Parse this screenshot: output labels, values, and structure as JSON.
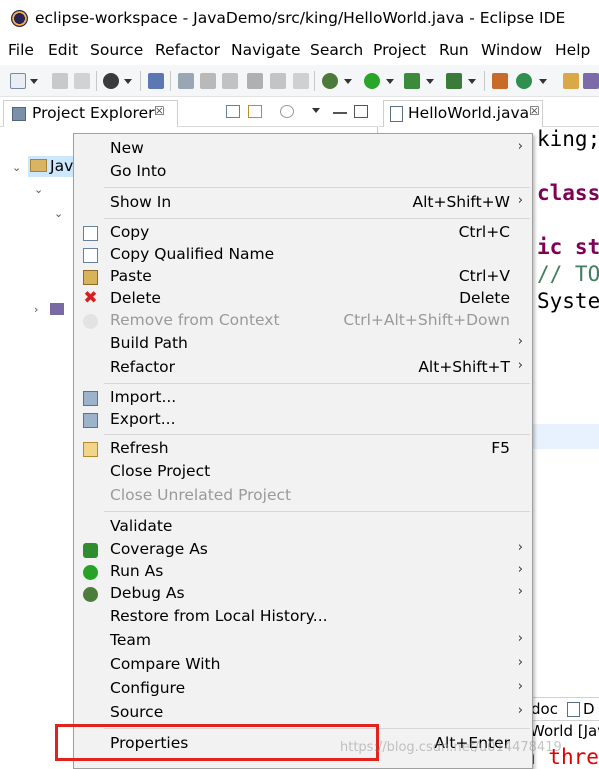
{
  "window": {
    "title": "eclipse-workspace - JavaDemo/src/king/HelloWorld.java - Eclipse IDE",
    "app_icon": "eclipse-icon"
  },
  "menubar": [
    "File",
    "Edit",
    "Source",
    "Refactor",
    "Navigate",
    "Search",
    "Project",
    "Run",
    "Window",
    "Help"
  ],
  "project_explorer": {
    "tab_label": "Project Explorer",
    "close_glyph": "☒",
    "tree_root_label": "Jav"
  },
  "editor": {
    "tab_label": "HelloWorld.java",
    "close_glyph": "☒",
    "code": {
      "line1": "king;",
      "line2": "class",
      "line3": "ic st",
      "line4_comment": "// TO",
      "line5": "Syste"
    }
  },
  "bottom_panel": {
    "tab_partial_1": "doc",
    "tab_partial_2": "D",
    "console_name": "World [Jav",
    "console_error": "Exception in thre"
  },
  "context_menu": {
    "groups": [
      [
        {
          "label": "New",
          "accel": "",
          "submenu": true,
          "disabled": false,
          "icon": ""
        },
        {
          "label": "Go Into",
          "accel": "",
          "submenu": false,
          "disabled": false,
          "icon": ""
        }
      ],
      [
        {
          "label": "Show In",
          "accel": "Alt+Shift+W",
          "submenu": true,
          "disabled": false,
          "icon": ""
        }
      ],
      [
        {
          "label": "Copy",
          "accel": "Ctrl+C",
          "submenu": false,
          "disabled": false,
          "icon": "copy-icon"
        },
        {
          "label": "Copy Qualified Name",
          "accel": "",
          "submenu": false,
          "disabled": false,
          "icon": "copy-qualified-name-icon"
        },
        {
          "label": "Paste",
          "accel": "Ctrl+V",
          "submenu": false,
          "disabled": false,
          "icon": "paste-icon"
        },
        {
          "label": "Delete",
          "accel": "Delete",
          "submenu": false,
          "disabled": false,
          "icon": "delete-icon"
        },
        {
          "label": "Remove from Context",
          "accel": "Ctrl+Alt+Shift+Down",
          "submenu": false,
          "disabled": true,
          "icon": "remove-from-context-icon"
        },
        {
          "label": "Build Path",
          "accel": "",
          "submenu": true,
          "disabled": false,
          "icon": ""
        },
        {
          "label": "Refactor",
          "accel": "Alt+Shift+T",
          "submenu": true,
          "disabled": false,
          "icon": ""
        }
      ],
      [
        {
          "label": "Import...",
          "accel": "",
          "submenu": false,
          "disabled": false,
          "icon": "import-icon"
        },
        {
          "label": "Export...",
          "accel": "",
          "submenu": false,
          "disabled": false,
          "icon": "export-icon"
        }
      ],
      [
        {
          "label": "Refresh",
          "accel": "F5",
          "submenu": false,
          "disabled": false,
          "icon": "refresh-icon"
        },
        {
          "label": "Close Project",
          "accel": "",
          "submenu": false,
          "disabled": false,
          "icon": ""
        },
        {
          "label": "Close Unrelated Project",
          "accel": "",
          "submenu": false,
          "disabled": true,
          "icon": ""
        }
      ],
      [
        {
          "label": "Validate",
          "accel": "",
          "submenu": false,
          "disabled": false,
          "icon": ""
        },
        {
          "label": "Coverage As",
          "accel": "",
          "submenu": true,
          "disabled": false,
          "icon": "coverage-icon"
        },
        {
          "label": "Run As",
          "accel": "",
          "submenu": true,
          "disabled": false,
          "icon": "run-icon"
        },
        {
          "label": "Debug As",
          "accel": "",
          "submenu": true,
          "disabled": false,
          "icon": "debug-icon"
        },
        {
          "label": "Restore from Local History...",
          "accel": "",
          "submenu": false,
          "disabled": false,
          "icon": ""
        },
        {
          "label": "Team",
          "accel": "",
          "submenu": true,
          "disabled": false,
          "icon": ""
        },
        {
          "label": "Compare With",
          "accel": "",
          "submenu": true,
          "disabled": false,
          "icon": ""
        },
        {
          "label": "Configure",
          "accel": "",
          "submenu": true,
          "disabled": false,
          "icon": ""
        },
        {
          "label": "Source",
          "accel": "",
          "submenu": true,
          "disabled": false,
          "icon": ""
        }
      ],
      [
        {
          "label": "Properties",
          "accel": "Alt+Enter",
          "submenu": false,
          "disabled": false,
          "icon": ""
        }
      ]
    ],
    "submenu_glyph": "›"
  },
  "annotation": {
    "highlight_color": "#e0231c",
    "highlighted_item": "Properties"
  },
  "watermark": "https://blog.csdn.net/u014478419",
  "colors": {
    "keyword": "#7f0055",
    "comment": "#3f7f5f",
    "error_text": "#e00000",
    "menu_bg": "#f2f2f2",
    "disabled_text": "#9a9a9a"
  }
}
